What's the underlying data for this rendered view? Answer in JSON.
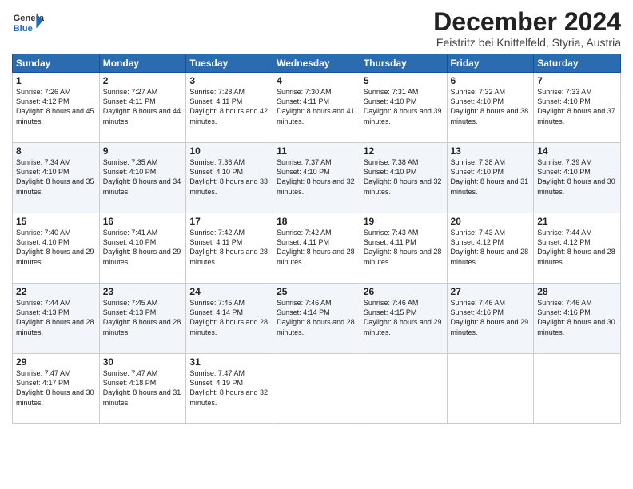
{
  "header": {
    "logo_general": "General",
    "logo_blue": "Blue",
    "month_title": "December 2024",
    "location": "Feistritz bei Knittelfeld, Styria, Austria"
  },
  "days_of_week": [
    "Sunday",
    "Monday",
    "Tuesday",
    "Wednesday",
    "Thursday",
    "Friday",
    "Saturday"
  ],
  "weeks": [
    [
      {
        "day": "1",
        "sunrise": "Sunrise: 7:26 AM",
        "sunset": "Sunset: 4:12 PM",
        "daylight": "Daylight: 8 hours and 45 minutes."
      },
      {
        "day": "2",
        "sunrise": "Sunrise: 7:27 AM",
        "sunset": "Sunset: 4:11 PM",
        "daylight": "Daylight: 8 hours and 44 minutes."
      },
      {
        "day": "3",
        "sunrise": "Sunrise: 7:28 AM",
        "sunset": "Sunset: 4:11 PM",
        "daylight": "Daylight: 8 hours and 42 minutes."
      },
      {
        "day": "4",
        "sunrise": "Sunrise: 7:30 AM",
        "sunset": "Sunset: 4:11 PM",
        "daylight": "Daylight: 8 hours and 41 minutes."
      },
      {
        "day": "5",
        "sunrise": "Sunrise: 7:31 AM",
        "sunset": "Sunset: 4:10 PM",
        "daylight": "Daylight: 8 hours and 39 minutes."
      },
      {
        "day": "6",
        "sunrise": "Sunrise: 7:32 AM",
        "sunset": "Sunset: 4:10 PM",
        "daylight": "Daylight: 8 hours and 38 minutes."
      },
      {
        "day": "7",
        "sunrise": "Sunrise: 7:33 AM",
        "sunset": "Sunset: 4:10 PM",
        "daylight": "Daylight: 8 hours and 37 minutes."
      }
    ],
    [
      {
        "day": "8",
        "sunrise": "Sunrise: 7:34 AM",
        "sunset": "Sunset: 4:10 PM",
        "daylight": "Daylight: 8 hours and 35 minutes."
      },
      {
        "day": "9",
        "sunrise": "Sunrise: 7:35 AM",
        "sunset": "Sunset: 4:10 PM",
        "daylight": "Daylight: 8 hours and 34 minutes."
      },
      {
        "day": "10",
        "sunrise": "Sunrise: 7:36 AM",
        "sunset": "Sunset: 4:10 PM",
        "daylight": "Daylight: 8 hours and 33 minutes."
      },
      {
        "day": "11",
        "sunrise": "Sunrise: 7:37 AM",
        "sunset": "Sunset: 4:10 PM",
        "daylight": "Daylight: 8 hours and 32 minutes."
      },
      {
        "day": "12",
        "sunrise": "Sunrise: 7:38 AM",
        "sunset": "Sunset: 4:10 PM",
        "daylight": "Daylight: 8 hours and 32 minutes."
      },
      {
        "day": "13",
        "sunrise": "Sunrise: 7:38 AM",
        "sunset": "Sunset: 4:10 PM",
        "daylight": "Daylight: 8 hours and 31 minutes."
      },
      {
        "day": "14",
        "sunrise": "Sunrise: 7:39 AM",
        "sunset": "Sunset: 4:10 PM",
        "daylight": "Daylight: 8 hours and 30 minutes."
      }
    ],
    [
      {
        "day": "15",
        "sunrise": "Sunrise: 7:40 AM",
        "sunset": "Sunset: 4:10 PM",
        "daylight": "Daylight: 8 hours and 29 minutes."
      },
      {
        "day": "16",
        "sunrise": "Sunrise: 7:41 AM",
        "sunset": "Sunset: 4:10 PM",
        "daylight": "Daylight: 8 hours and 29 minutes."
      },
      {
        "day": "17",
        "sunrise": "Sunrise: 7:42 AM",
        "sunset": "Sunset: 4:11 PM",
        "daylight": "Daylight: 8 hours and 28 minutes."
      },
      {
        "day": "18",
        "sunrise": "Sunrise: 7:42 AM",
        "sunset": "Sunset: 4:11 PM",
        "daylight": "Daylight: 8 hours and 28 minutes."
      },
      {
        "day": "19",
        "sunrise": "Sunrise: 7:43 AM",
        "sunset": "Sunset: 4:11 PM",
        "daylight": "Daylight: 8 hours and 28 minutes."
      },
      {
        "day": "20",
        "sunrise": "Sunrise: 7:43 AM",
        "sunset": "Sunset: 4:12 PM",
        "daylight": "Daylight: 8 hours and 28 minutes."
      },
      {
        "day": "21",
        "sunrise": "Sunrise: 7:44 AM",
        "sunset": "Sunset: 4:12 PM",
        "daylight": "Daylight: 8 hours and 28 minutes."
      }
    ],
    [
      {
        "day": "22",
        "sunrise": "Sunrise: 7:44 AM",
        "sunset": "Sunset: 4:13 PM",
        "daylight": "Daylight: 8 hours and 28 minutes."
      },
      {
        "day": "23",
        "sunrise": "Sunrise: 7:45 AM",
        "sunset": "Sunset: 4:13 PM",
        "daylight": "Daylight: 8 hours and 28 minutes."
      },
      {
        "day": "24",
        "sunrise": "Sunrise: 7:45 AM",
        "sunset": "Sunset: 4:14 PM",
        "daylight": "Daylight: 8 hours and 28 minutes."
      },
      {
        "day": "25",
        "sunrise": "Sunrise: 7:46 AM",
        "sunset": "Sunset: 4:14 PM",
        "daylight": "Daylight: 8 hours and 28 minutes."
      },
      {
        "day": "26",
        "sunrise": "Sunrise: 7:46 AM",
        "sunset": "Sunset: 4:15 PM",
        "daylight": "Daylight: 8 hours and 29 minutes."
      },
      {
        "day": "27",
        "sunrise": "Sunrise: 7:46 AM",
        "sunset": "Sunset: 4:16 PM",
        "daylight": "Daylight: 8 hours and 29 minutes."
      },
      {
        "day": "28",
        "sunrise": "Sunrise: 7:46 AM",
        "sunset": "Sunset: 4:16 PM",
        "daylight": "Daylight: 8 hours and 30 minutes."
      }
    ],
    [
      {
        "day": "29",
        "sunrise": "Sunrise: 7:47 AM",
        "sunset": "Sunset: 4:17 PM",
        "daylight": "Daylight: 8 hours and 30 minutes."
      },
      {
        "day": "30",
        "sunrise": "Sunrise: 7:47 AM",
        "sunset": "Sunset: 4:18 PM",
        "daylight": "Daylight: 8 hours and 31 minutes."
      },
      {
        "day": "31",
        "sunrise": "Sunrise: 7:47 AM",
        "sunset": "Sunset: 4:19 PM",
        "daylight": "Daylight: 8 hours and 32 minutes."
      },
      null,
      null,
      null,
      null
    ]
  ]
}
